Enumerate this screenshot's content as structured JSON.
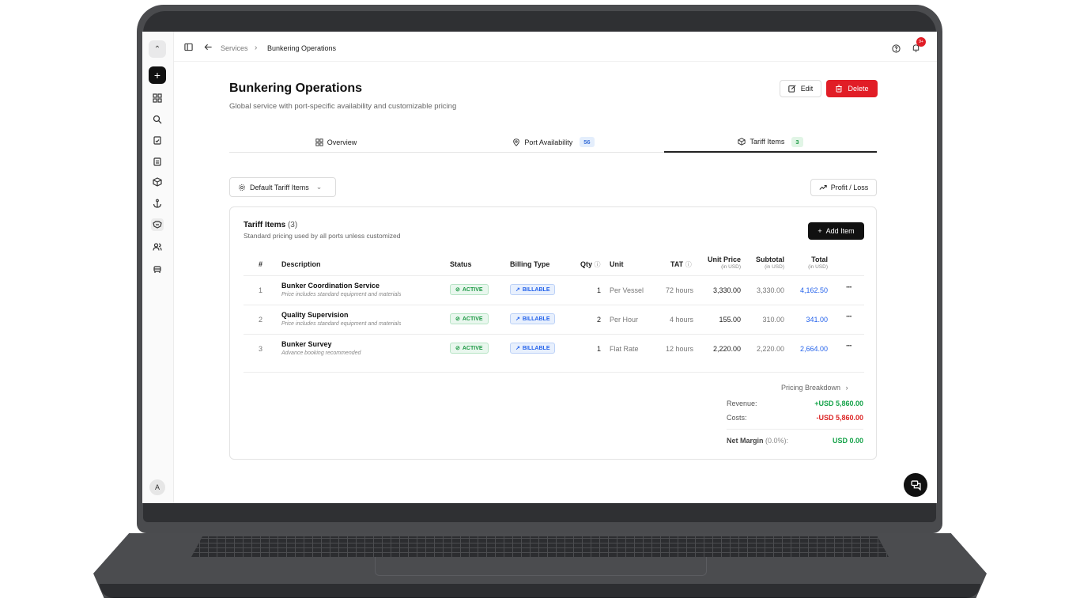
{
  "app": {
    "logo_glyph": "⌃",
    "avatar_initial": "A",
    "notification_badge": "9+"
  },
  "breadcrumb": {
    "parent": "Services",
    "current": "Bunkering Operations"
  },
  "header": {
    "title": "Bunkering Operations",
    "subtitle": "Global service with port-specific availability and customizable pricing",
    "edit_label": "Edit",
    "delete_label": "Delete"
  },
  "tabs": [
    {
      "label": "Overview",
      "count": "",
      "active": false
    },
    {
      "label": "Port Availability",
      "count": "56",
      "active": false
    },
    {
      "label": "Tariff Items",
      "count": "3",
      "active": true
    }
  ],
  "toolbar": {
    "dropdown_label": "Default Tariff Items",
    "profit_loss_label": "Profit / Loss"
  },
  "tariff_card": {
    "title": "Tariff Items",
    "count": "(3)",
    "subtitle": "Standard pricing used by all ports unless customized",
    "add_label": "Add Item",
    "columns": {
      "num": "#",
      "description": "Description",
      "status": "Status",
      "billing_type": "Billing Type",
      "qty": "Qty",
      "unit": "Unit",
      "tat": "TAT",
      "unit_price": "Unit Price",
      "subtotal": "Subtotal",
      "total": "Total",
      "currency_note": "(in USD)"
    },
    "rows": [
      {
        "num": "1",
        "title": "Bunker Coordination Service",
        "note": "Price includes standard equipment and materials",
        "status": "ACTIVE",
        "billing": "BILLABLE",
        "qty": "1",
        "unit": "Per Vessel",
        "tat": "72 hours",
        "unit_price": "3,330.00",
        "subtotal": "3,330.00",
        "total": "4,162.50"
      },
      {
        "num": "2",
        "title": "Quality Supervision",
        "note": "Price includes standard equipment and materials",
        "status": "ACTIVE",
        "billing": "BILLABLE",
        "qty": "2",
        "unit": "Per Hour",
        "tat": "4 hours",
        "unit_price": "155.00",
        "subtotal": "310.00",
        "total": "341.00"
      },
      {
        "num": "3",
        "title": "Bunker Survey",
        "note": "Advance booking recommended",
        "status": "ACTIVE",
        "billing": "BILLABLE",
        "qty": "1",
        "unit": "Flat Rate",
        "tat": "12 hours",
        "unit_price": "2,220.00",
        "subtotal": "2,220.00",
        "total": "2,664.00"
      }
    ],
    "summary": {
      "breakdown_label": "Pricing Breakdown",
      "revenue_label": "Revenue:",
      "revenue_value": "+USD 5,860.00",
      "costs_label": "Costs:",
      "costs_value": "-USD 5,860.00",
      "net_label": "Net Margin",
      "net_pct": "(0.0%):",
      "net_value": "USD 0.00"
    }
  },
  "colors": {
    "accent_red": "#e11d26",
    "link_blue": "#2563eb",
    "positive_green": "#16a34a"
  }
}
